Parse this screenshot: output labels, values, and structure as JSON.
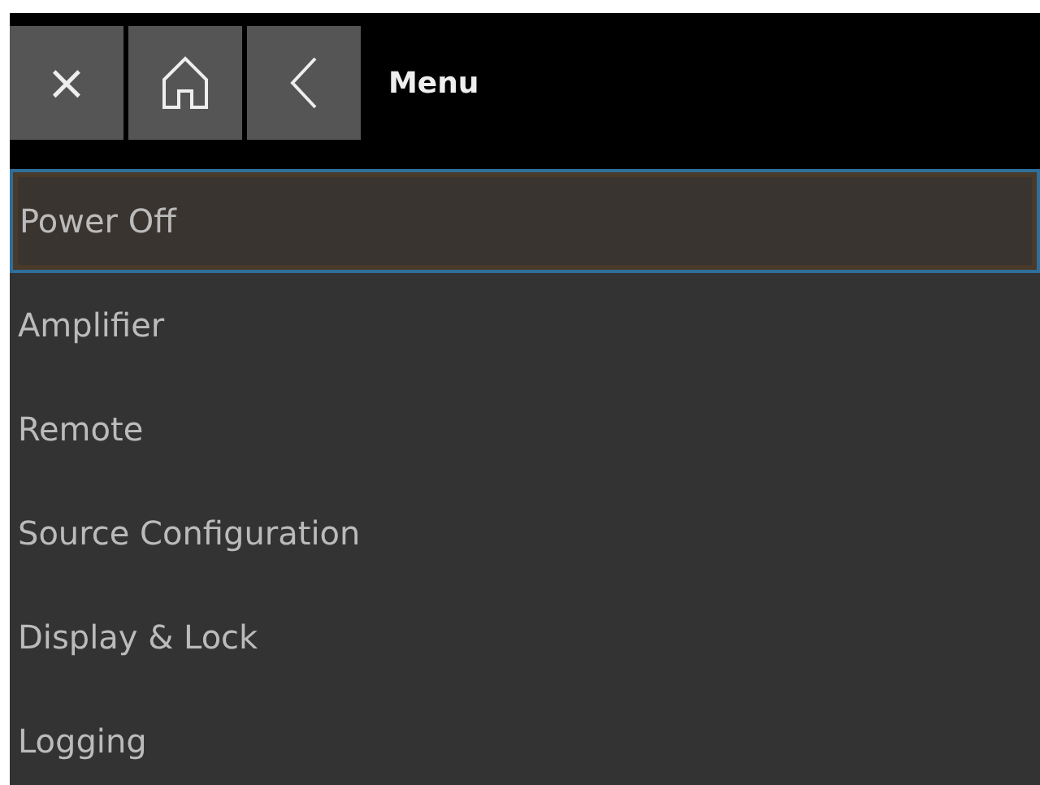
{
  "toolbar": {
    "buttons": [
      {
        "kind": "close",
        "label": "×"
      },
      {
        "kind": "home"
      },
      {
        "kind": "back"
      }
    ],
    "title": "Menu"
  },
  "menu": [
    {
      "label": "Power Off",
      "selected": true
    },
    {
      "label": "Amplifier",
      "selected": false
    },
    {
      "label": "Remote",
      "selected": false
    },
    {
      "label": "Source Configuration",
      "selected": false
    },
    {
      "label": "Display & Lock",
      "selected": false
    },
    {
      "label": "Logging",
      "selected": false
    }
  ]
}
